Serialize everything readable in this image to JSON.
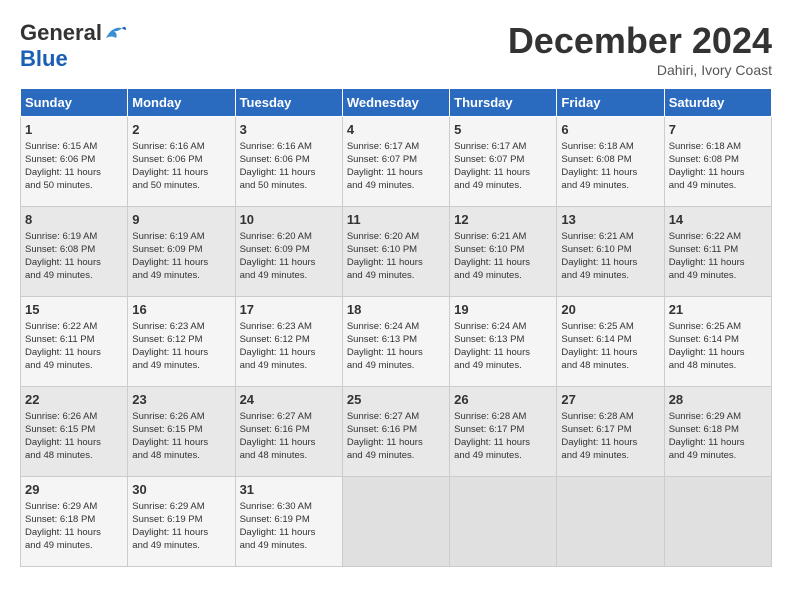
{
  "logo": {
    "line1": "General",
    "line2": "Blue",
    "bird_unicode": "🐦"
  },
  "title": "December 2024",
  "location": "Dahiri, Ivory Coast",
  "days_of_week": [
    "Sunday",
    "Monday",
    "Tuesday",
    "Wednesday",
    "Thursday",
    "Friday",
    "Saturday"
  ],
  "weeks": [
    [
      {
        "day": "1",
        "info": "Sunrise: 6:15 AM\nSunset: 6:06 PM\nDaylight: 11 hours\nand 50 minutes."
      },
      {
        "day": "2",
        "info": "Sunrise: 6:16 AM\nSunset: 6:06 PM\nDaylight: 11 hours\nand 50 minutes."
      },
      {
        "day": "3",
        "info": "Sunrise: 6:16 AM\nSunset: 6:06 PM\nDaylight: 11 hours\nand 50 minutes."
      },
      {
        "day": "4",
        "info": "Sunrise: 6:17 AM\nSunset: 6:07 PM\nDaylight: 11 hours\nand 49 minutes."
      },
      {
        "day": "5",
        "info": "Sunrise: 6:17 AM\nSunset: 6:07 PM\nDaylight: 11 hours\nand 49 minutes."
      },
      {
        "day": "6",
        "info": "Sunrise: 6:18 AM\nSunset: 6:08 PM\nDaylight: 11 hours\nand 49 minutes."
      },
      {
        "day": "7",
        "info": "Sunrise: 6:18 AM\nSunset: 6:08 PM\nDaylight: 11 hours\nand 49 minutes."
      }
    ],
    [
      {
        "day": "8",
        "info": "Sunrise: 6:19 AM\nSunset: 6:08 PM\nDaylight: 11 hours\nand 49 minutes."
      },
      {
        "day": "9",
        "info": "Sunrise: 6:19 AM\nSunset: 6:09 PM\nDaylight: 11 hours\nand 49 minutes."
      },
      {
        "day": "10",
        "info": "Sunrise: 6:20 AM\nSunset: 6:09 PM\nDaylight: 11 hours\nand 49 minutes."
      },
      {
        "day": "11",
        "info": "Sunrise: 6:20 AM\nSunset: 6:10 PM\nDaylight: 11 hours\nand 49 minutes."
      },
      {
        "day": "12",
        "info": "Sunrise: 6:21 AM\nSunset: 6:10 PM\nDaylight: 11 hours\nand 49 minutes."
      },
      {
        "day": "13",
        "info": "Sunrise: 6:21 AM\nSunset: 6:10 PM\nDaylight: 11 hours\nand 49 minutes."
      },
      {
        "day": "14",
        "info": "Sunrise: 6:22 AM\nSunset: 6:11 PM\nDaylight: 11 hours\nand 49 minutes."
      }
    ],
    [
      {
        "day": "15",
        "info": "Sunrise: 6:22 AM\nSunset: 6:11 PM\nDaylight: 11 hours\nand 49 minutes."
      },
      {
        "day": "16",
        "info": "Sunrise: 6:23 AM\nSunset: 6:12 PM\nDaylight: 11 hours\nand 49 minutes."
      },
      {
        "day": "17",
        "info": "Sunrise: 6:23 AM\nSunset: 6:12 PM\nDaylight: 11 hours\nand 49 minutes."
      },
      {
        "day": "18",
        "info": "Sunrise: 6:24 AM\nSunset: 6:13 PM\nDaylight: 11 hours\nand 49 minutes."
      },
      {
        "day": "19",
        "info": "Sunrise: 6:24 AM\nSunset: 6:13 PM\nDaylight: 11 hours\nand 49 minutes."
      },
      {
        "day": "20",
        "info": "Sunrise: 6:25 AM\nSunset: 6:14 PM\nDaylight: 11 hours\nand 48 minutes."
      },
      {
        "day": "21",
        "info": "Sunrise: 6:25 AM\nSunset: 6:14 PM\nDaylight: 11 hours\nand 48 minutes."
      }
    ],
    [
      {
        "day": "22",
        "info": "Sunrise: 6:26 AM\nSunset: 6:15 PM\nDaylight: 11 hours\nand 48 minutes."
      },
      {
        "day": "23",
        "info": "Sunrise: 6:26 AM\nSunset: 6:15 PM\nDaylight: 11 hours\nand 48 minutes."
      },
      {
        "day": "24",
        "info": "Sunrise: 6:27 AM\nSunset: 6:16 PM\nDaylight: 11 hours\nand 48 minutes."
      },
      {
        "day": "25",
        "info": "Sunrise: 6:27 AM\nSunset: 6:16 PM\nDaylight: 11 hours\nand 49 minutes."
      },
      {
        "day": "26",
        "info": "Sunrise: 6:28 AM\nSunset: 6:17 PM\nDaylight: 11 hours\nand 49 minutes."
      },
      {
        "day": "27",
        "info": "Sunrise: 6:28 AM\nSunset: 6:17 PM\nDaylight: 11 hours\nand 49 minutes."
      },
      {
        "day": "28",
        "info": "Sunrise: 6:29 AM\nSunset: 6:18 PM\nDaylight: 11 hours\nand 49 minutes."
      }
    ],
    [
      {
        "day": "29",
        "info": "Sunrise: 6:29 AM\nSunset: 6:18 PM\nDaylight: 11 hours\nand 49 minutes."
      },
      {
        "day": "30",
        "info": "Sunrise: 6:29 AM\nSunset: 6:19 PM\nDaylight: 11 hours\nand 49 minutes."
      },
      {
        "day": "31",
        "info": "Sunrise: 6:30 AM\nSunset: 6:19 PM\nDaylight: 11 hours\nand 49 minutes."
      },
      {
        "day": "",
        "info": ""
      },
      {
        "day": "",
        "info": ""
      },
      {
        "day": "",
        "info": ""
      },
      {
        "day": "",
        "info": ""
      }
    ]
  ]
}
